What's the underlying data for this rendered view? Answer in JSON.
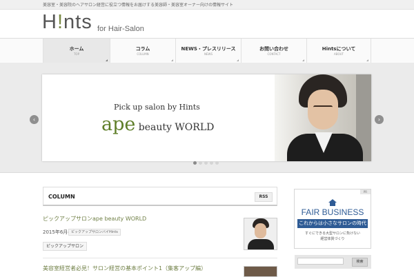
{
  "topbar": {
    "text": "美容室・美容院のヘアサロン経営に役立つ情報をお届けする美容師・美容室オーナー向けの情報サイト"
  },
  "logo": {
    "main_h": "H",
    "main_accent": "!",
    "main_rest": "nts",
    "sub": "for Hair-Salon"
  },
  "nav": {
    "items": [
      {
        "label": "ホーム",
        "sub": "TOP"
      },
      {
        "label": "コラム",
        "sub": "COLUMN"
      },
      {
        "label": "NEWS・プレスリリース",
        "sub": "NEWS"
      },
      {
        "label": "お問い合わせ",
        "sub": "CONTACT"
      },
      {
        "label": "Hintsについて",
        "sub": "ABOUT"
      }
    ]
  },
  "slider": {
    "kicker": "Pick up salon by Hints",
    "title_big": "ape",
    "title_small": " beauty WORLD",
    "prev_label": "‹",
    "next_label": "›",
    "dots": 5,
    "active_dot": 1
  },
  "column": {
    "title": "COLUMN",
    "rss_label": "RSS",
    "posts": [
      {
        "title": "ピックアップサロンape beauty WORLD",
        "date": "2015年6月4日",
        "category": "ピックアップサロンバイHints",
        "tag": "ピックアップサロン"
      },
      {
        "title": "美容室経営者必見！サロン経営の基本ポイント1（集客アップ編）"
      }
    ]
  },
  "ad": {
    "pr": "PR",
    "name": "FAIR BUSINESS",
    "band": "これからは小さなサロンの時代",
    "line1": "すぐにできる大型サロンに負けない",
    "line2": "経営体質づくり"
  },
  "search": {
    "placeholder": "",
    "button": "検索"
  }
}
